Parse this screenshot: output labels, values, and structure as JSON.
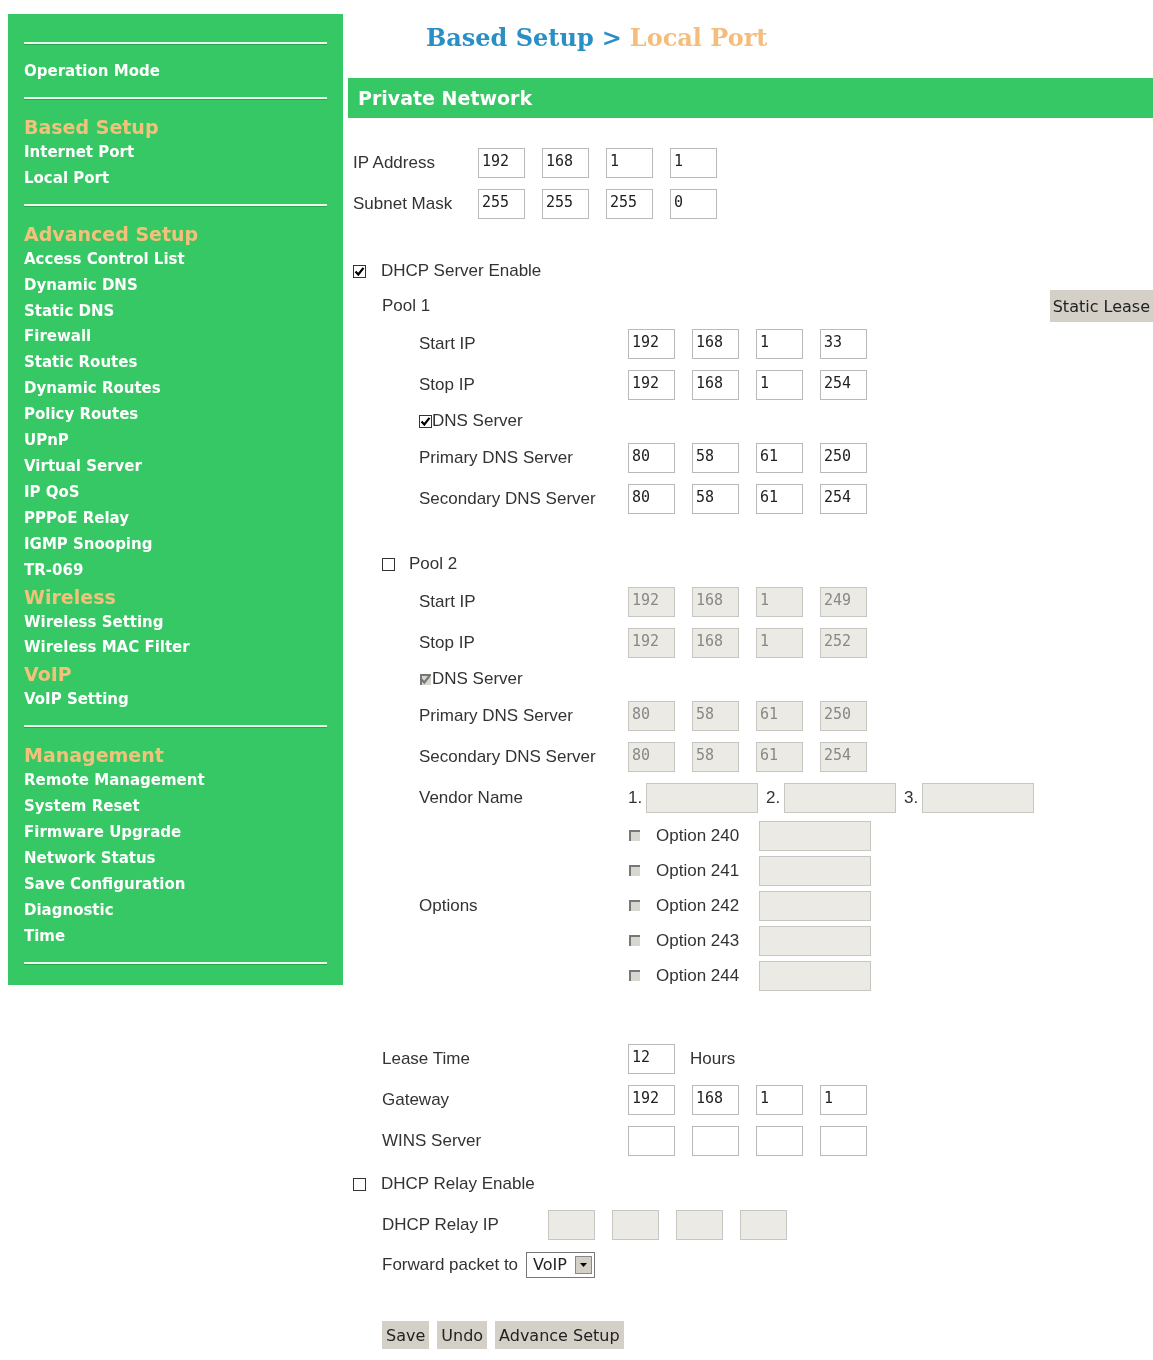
{
  "sidebar": {
    "sections": [
      {
        "groups": [
          {
            "items": [
              "Operation Mode"
            ]
          }
        ]
      },
      {
        "groups": [
          {
            "heading": "Based Setup",
            "items": [
              "Internet Port",
              "Local Port"
            ]
          }
        ]
      },
      {
        "groups": [
          {
            "heading": "Advanced Setup",
            "items": [
              "Access Control List",
              "Dynamic DNS",
              "Static DNS",
              "Firewall",
              "Static Routes",
              "Dynamic Routes",
              "Policy Routes",
              "UPnP",
              "Virtual Server",
              "IP QoS",
              "PPPoE Relay",
              "IGMP Snooping",
              "TR-069"
            ]
          },
          {
            "heading": "Wireless",
            "items": [
              "Wireless Setting",
              "Wireless MAC Filter"
            ]
          },
          {
            "heading": "VoIP",
            "items": [
              "VoIP Setting"
            ]
          }
        ]
      },
      {
        "groups": [
          {
            "heading": "Management",
            "items": [
              "Remote Management",
              "System Reset",
              "Firmware Upgrade",
              "Network Status",
              "Save Configuration",
              "Diagnostic",
              "Time"
            ]
          }
        ]
      }
    ]
  },
  "breadcrumb": {
    "parent": "Based Setup",
    "separator": ">",
    "current": "Local Port"
  },
  "section_title": "Private Network",
  "network": [
    {
      "label": "IP Address",
      "octets": [
        "192",
        "168",
        "1",
        "1"
      ]
    },
    {
      "label": "Subnet Mask",
      "octets": [
        "255",
        "255",
        "255",
        "0"
      ]
    }
  ],
  "dhcp_server": {
    "label": "DHCP Server Enable",
    "checked": true
  },
  "pools": [
    {
      "label": "Pool 1",
      "kind": "plain",
      "disabled": false,
      "action": "Static Lease",
      "rows": [
        {
          "kind": "ip",
          "label": "Start IP",
          "octets": [
            "192",
            "168",
            "1",
            "33"
          ]
        },
        {
          "kind": "ip",
          "label": "Stop IP",
          "octets": [
            "192",
            "168",
            "1",
            "254"
          ]
        },
        {
          "kind": "check",
          "label": "DNS Server",
          "checked": true
        },
        {
          "kind": "ip",
          "label": "Primary DNS Server",
          "octets": [
            "80",
            "58",
            "61",
            "250"
          ]
        },
        {
          "kind": "ip",
          "label": "Secondary DNS Server",
          "octets": [
            "80",
            "58",
            "61",
            "254"
          ]
        }
      ]
    },
    {
      "label": "Pool 2",
      "kind": "checkbox",
      "checked": false,
      "disabled": true,
      "rows": [
        {
          "kind": "ip",
          "label": "Start IP",
          "octets": [
            "192",
            "168",
            "1",
            "249"
          ]
        },
        {
          "kind": "ip",
          "label": "Stop IP",
          "octets": [
            "192",
            "168",
            "1",
            "252"
          ]
        },
        {
          "kind": "check",
          "label": "DNS Server",
          "checked": true
        },
        {
          "kind": "ip",
          "label": "Primary DNS Server",
          "octets": [
            "80",
            "58",
            "61",
            "250"
          ]
        },
        {
          "kind": "ip",
          "label": "Secondary DNS Server",
          "octets": [
            "80",
            "58",
            "61",
            "254"
          ]
        },
        {
          "kind": "vendor",
          "label": "Vendor Name",
          "slots": [
            "1.",
            "2.",
            "3."
          ]
        },
        {
          "kind": "options",
          "label": "Options",
          "items": [
            {
              "label": "Option 240",
              "checked": false
            },
            {
              "label": "Option 241",
              "checked": false
            },
            {
              "label": "Option 242",
              "checked": false
            },
            {
              "label": "Option 243",
              "checked": false
            },
            {
              "label": "Option 244",
              "checked": false
            }
          ]
        }
      ]
    }
  ],
  "lease_time": {
    "label": "Lease Time",
    "value": "12",
    "unit": "Hours"
  },
  "server_rows": [
    {
      "kind": "ip",
      "label": "Gateway",
      "octets": [
        "192",
        "168",
        "1",
        "1"
      ]
    },
    {
      "kind": "blank",
      "label": "WINS Server"
    }
  ],
  "dhcp_relay": {
    "label": "DHCP Relay Enable",
    "checked": false
  },
  "relay_ip": {
    "label": "DHCP Relay IP",
    "disabled": true
  },
  "forward": {
    "label": "Forward packet to",
    "value": "VoIP"
  },
  "buttons": [
    "Save",
    "Undo",
    "Advance Setup"
  ]
}
